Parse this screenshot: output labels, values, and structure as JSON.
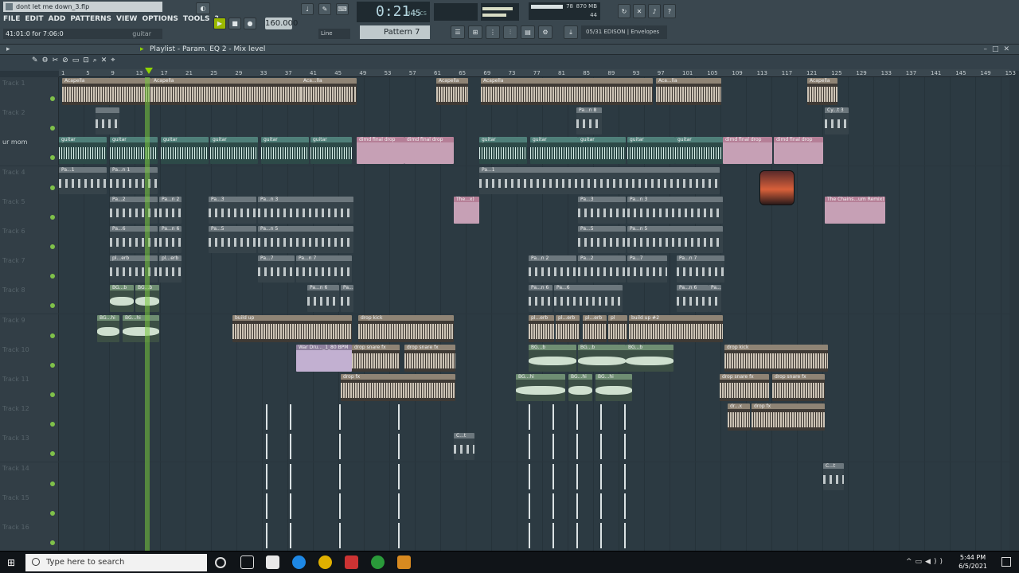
{
  "window_title": "dont let me down_3.flp",
  "menu": [
    "FILE",
    "EDIT",
    "ADD",
    "PATTERNS",
    "VIEW",
    "OPTIONS",
    "TOOLS",
    "?"
  ],
  "hint": {
    "position": "41:01:0 for 7:06:0",
    "target": "guitar"
  },
  "transport": {
    "time": "0:21",
    "time_sub": "45",
    "time_unit": "M:S:CS",
    "tempo": "160.000",
    "pattern": "Pattern 7",
    "snap": "Line"
  },
  "cpu": {
    "value": "78",
    "memory": "870 MB",
    "polyphony": "44"
  },
  "browser_hint": "05/31  EDISON | Envelopes",
  "playlist_title": "Playlist - Param. EQ 2 - Mix level",
  "ruler": [
    "1",
    "5",
    "9",
    "13",
    "17",
    "21",
    "25",
    "29",
    "33",
    "37",
    "41",
    "45",
    "49",
    "53",
    "57",
    "61",
    "65",
    "69",
    "73",
    "77",
    "81",
    "85",
    "89",
    "93",
    "97",
    "101",
    "105",
    "109",
    "113",
    "117",
    "121",
    "125",
    "129",
    "133",
    "137",
    "141",
    "145",
    "149",
    "153"
  ],
  "tracks": [
    {
      "name": "Track 1",
      "clips": [
        {
          "label": "Acapella",
          "color": "tan"
        },
        {
          "label": "Acapella",
          "color": "tan"
        },
        {
          "label": "Aca...lla",
          "color": "tan"
        },
        {
          "label": "Acapella",
          "color": "tan"
        },
        {
          "label": "Acapella",
          "color": "tan"
        },
        {
          "label": "Aca...lla",
          "color": "tan"
        },
        {
          "label": "Acapella",
          "color": "tan"
        }
      ]
    },
    {
      "name": "Track 2",
      "clips": [
        {
          "label": "",
          "color": "grey"
        },
        {
          "label": "Pa...n 8",
          "color": "grey"
        },
        {
          "label": "Cy...t 3",
          "color": "grey"
        }
      ]
    },
    {
      "name": "ur mom",
      "clips": [
        {
          "label": "guitar",
          "color": "teal"
        },
        {
          "label": "guitar",
          "color": "teal"
        },
        {
          "label": "guitar",
          "color": "teal"
        },
        {
          "label": "guitar",
          "color": "teal"
        },
        {
          "label": "guitar",
          "color": "teal"
        },
        {
          "label": "guitar",
          "color": "teal"
        },
        {
          "label": "dimd final drop",
          "color": "pink"
        },
        {
          "label": "dimd final drop",
          "color": "pink"
        },
        {
          "label": "guitar",
          "color": "teal"
        },
        {
          "label": "guitar",
          "color": "teal"
        },
        {
          "label": "guitar",
          "color": "teal"
        },
        {
          "label": "guitar",
          "color": "teal"
        },
        {
          "label": "guitar",
          "color": "teal"
        },
        {
          "label": "dimd final drop",
          "color": "pink"
        },
        {
          "label": "dimd final drop",
          "color": "pink"
        }
      ]
    },
    {
      "name": "Track 4",
      "clips": [
        {
          "label": "Pa...1",
          "color": "grey"
        },
        {
          "label": "Pa...n 1",
          "color": "grey"
        },
        {
          "label": "Pa...1",
          "color": "grey"
        }
      ]
    },
    {
      "name": "Track 5",
      "clips": [
        {
          "label": "Pa...2",
          "color": "grey"
        },
        {
          "label": "Pa...n 2",
          "color": "grey"
        },
        {
          "label": "Pa...3",
          "color": "grey"
        },
        {
          "label": "Pa...n 3",
          "color": "grey"
        },
        {
          "label": "The...x)",
          "color": "pink"
        },
        {
          "label": "Pa...3",
          "color": "grey"
        },
        {
          "label": "Pa...n 3",
          "color": "grey"
        },
        {
          "label": "The Chains...um Remix)",
          "color": "pink"
        }
      ]
    },
    {
      "name": "Track 6",
      "clips": [
        {
          "label": "Pa...6",
          "color": "grey"
        },
        {
          "label": "Pa...n 6",
          "color": "grey"
        },
        {
          "label": "Pa...5",
          "color": "grey"
        },
        {
          "label": "Pa...n 5",
          "color": "grey"
        },
        {
          "label": "Pa...5",
          "color": "grey"
        },
        {
          "label": "Pa...n 5",
          "color": "grey"
        }
      ]
    },
    {
      "name": "Track 7",
      "clips": [
        {
          "label": "pl...erb",
          "color": "grey"
        },
        {
          "label": "pl...erb",
          "color": "grey"
        },
        {
          "label": "Pa...7",
          "color": "grey"
        },
        {
          "label": "Pa...n 7",
          "color": "grey"
        },
        {
          "label": "Pa...n 2",
          "color": "grey"
        },
        {
          "label": "Pa...2",
          "color": "grey"
        },
        {
          "label": "Pa...7",
          "color": "grey"
        },
        {
          "label": "Pa...n 7",
          "color": "grey"
        }
      ]
    },
    {
      "name": "Track 8",
      "clips": [
        {
          "label": "BG...b",
          "color": "green"
        },
        {
          "label": "BG...b",
          "color": "green"
        },
        {
          "label": "Pa...n 6",
          "color": "grey"
        },
        {
          "label": "Pa...6",
          "color": "grey"
        },
        {
          "label": "Pa...n 6",
          "color": "grey"
        },
        {
          "label": "Pa...6",
          "color": "grey"
        },
        {
          "label": "Pa...n 6",
          "color": "grey"
        },
        {
          "label": "Pa...6",
          "color": "grey"
        }
      ]
    },
    {
      "name": "Track 9",
      "clips": [
        {
          "label": "BG...hi",
          "color": "green"
        },
        {
          "label": "BG...hi",
          "color": "green"
        },
        {
          "label": "build up",
          "color": "tan"
        },
        {
          "label": "drop kick",
          "color": "tan"
        },
        {
          "label": "pl...erb",
          "color": "tan"
        },
        {
          "label": "pl...erb",
          "color": "tan"
        },
        {
          "label": "pl...erb",
          "color": "tan"
        },
        {
          "label": "pl",
          "color": "tan"
        },
        {
          "label": "build up #2",
          "color": "tan"
        }
      ]
    },
    {
      "name": "Track 10",
      "clips": [
        {
          "label": "War Dru..._1_80 BPM",
          "color": "purple"
        },
        {
          "label": "drop snare fx",
          "color": "tan"
        },
        {
          "label": "drop snare fx",
          "color": "tan"
        },
        {
          "label": "BG...b",
          "color": "green"
        },
        {
          "label": "BG...b",
          "color": "green"
        },
        {
          "label": "BG...b",
          "color": "green"
        },
        {
          "label": "drop kick",
          "color": "tan"
        }
      ]
    },
    {
      "name": "Track 11",
      "clips": [
        {
          "label": "drop fx",
          "color": "tan"
        },
        {
          "label": "BG...hi",
          "color": "green"
        },
        {
          "label": "BG...hi",
          "color": "green"
        },
        {
          "label": "BG...hi",
          "color": "green"
        },
        {
          "label": "drop snare fx",
          "color": "tan"
        },
        {
          "label": "drop snare fx",
          "color": "tan"
        }
      ]
    },
    {
      "name": "Track 12",
      "clips": [
        {
          "label": "dr...x",
          "color": "tan"
        },
        {
          "label": "drop fx",
          "color": "tan"
        }
      ]
    },
    {
      "name": "Track 13",
      "clips": [
        {
          "label": "C...t",
          "color": "grey"
        }
      ]
    },
    {
      "name": "Track 14",
      "clips": [
        {
          "label": "C...t",
          "color": "grey"
        }
      ]
    },
    {
      "name": "Track 15",
      "clips": []
    },
    {
      "name": "Track 16",
      "clips": []
    }
  ],
  "taskbar": {
    "search_placeholder": "Type here to search",
    "time": "5:44 PM",
    "date": "6/5/2021"
  },
  "colors": {
    "tan": "#8f8475",
    "teal": "#4f7f79",
    "pink": "#b57f97",
    "grey": "#6c777d",
    "green": "#6f8e73",
    "purple": "#8e7f9c",
    "playhead": "#8ed400"
  }
}
